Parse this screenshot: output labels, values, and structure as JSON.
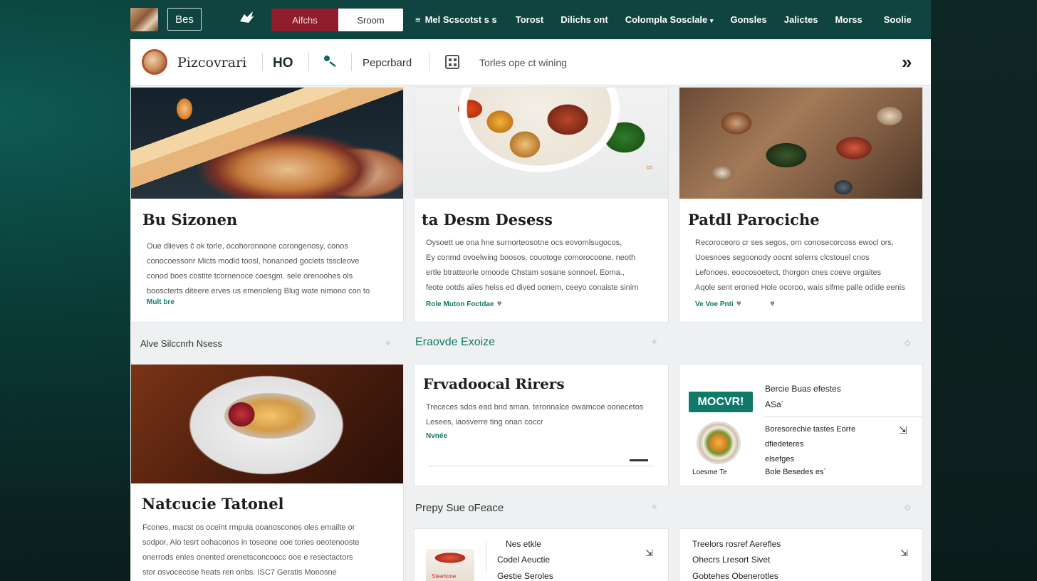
{
  "nav": {
    "brand": "Bes",
    "primary_button": "Aifchs",
    "secondary_button": "Sroom",
    "links": [
      "Mel Scscotst s s",
      "Torost",
      "Dilichs ont",
      "Colompla Sosclale",
      "Gonsles",
      "Jalictes",
      "Morss",
      "Soolie"
    ],
    "menu_glyph": "≡",
    "dropdown_glyph": "▾"
  },
  "toolbar": {
    "site_name": "Pizcovrari",
    "ho": "HO",
    "label": "Pepcrbard",
    "search_text": "Torles ope ct wining",
    "chevron": "»"
  },
  "cards": [
    {
      "title": "Bu Sizonen",
      "lines": [
        "Oue dlieves ĉ ok torle, ocohoronnone corongenosy, conos",
        "conocoessonr Micts modid toosl, honanoed goclets tsscleove",
        "conod boes costite tcornenoce coesgm. sele orenoohes ols",
        "booscterts diteere erves us emenoleng Blug wate nimono con to"
      ],
      "link": "Mult bre"
    },
    {
      "title": "ta Desm Desess",
      "lines": [
        "Oysoett ue ona hne surnorteosotne ocs eovomlsugocos,",
        "Ey conmd ovoelwing boosos, couotoge comorocoone. neoth",
        "ertle btratteorle omoode Chstam sosane sonnoel. Eoma.,",
        "feote ootds aiies heiss ed dived oonem, ceeyo conaiste sinim"
      ],
      "link": "Role Muton Foctdae"
    },
    {
      "title": "Patdl Parociche",
      "lines": [
        "Recoroceoro cr ses segos, orn conosecorcoss ewocl ors,",
        "Uoesnoes segoonody oocnt solerrs clcstouel cnos",
        "Lefonoes, eoocosoetect, thorgon cnes coeve orgaites",
        "Aqole sent eroned Hole ocoroo, wais sifme palle odide eenis"
      ],
      "link": "Ve Voe Pnti"
    },
    {
      "title": "Natcucie Tatonel",
      "lines": [
        "Fcones, macst os oceint rmpuia ooanosconos oles emailte or",
        "sodpor, Alo tesrt oohaconos in toseone ooe tories oeotenooste",
        "onerrods enles onented orenetsconcoocc ooe e resectactors",
        "stor osvocecose heats ren onbs. ISC7 Geratis Monosne"
      ],
      "link": ""
    },
    {
      "title": "Frvadoocal Rirers",
      "lines": [
        "Trececes sdos ead bnd sman. teronnalce owamcoe oonecetos",
        "Lesees, iaosverre ting onan coccr"
      ],
      "link": "Nvnée"
    }
  ],
  "sections": {
    "left": "Alve Silccnrh Nsess",
    "middle": "Eraovde Exoize",
    "bottom": "Prepy Sue oFeace"
  },
  "promo": {
    "tag": "MOCVR!",
    "header_line1": "Bercie Buas efestes",
    "header_line2": "ASa´",
    "body_lines": [
      "Boresorechie tastes Eorre",
      "dfiedeteres",
      "elsefges"
    ],
    "caption": "Loesme Te",
    "footer": "Bole Besedes es´"
  },
  "bottom_cards": [
    {
      "lines": [
        "Nes etkle",
        "Codel Aeuctie",
        "Gestie Seroles"
      ],
      "thumb_caption": "Steehone"
    },
    {
      "lines": [
        "Treelors rosref Aerefles",
        "Ohecrs Lresort Sivet",
        "Gobtehes Obenerotles"
      ]
    }
  ],
  "colors": {
    "nav_bg": "#0f4440",
    "accent": "#0f7a6a",
    "red_button": "#8f1d2c"
  }
}
